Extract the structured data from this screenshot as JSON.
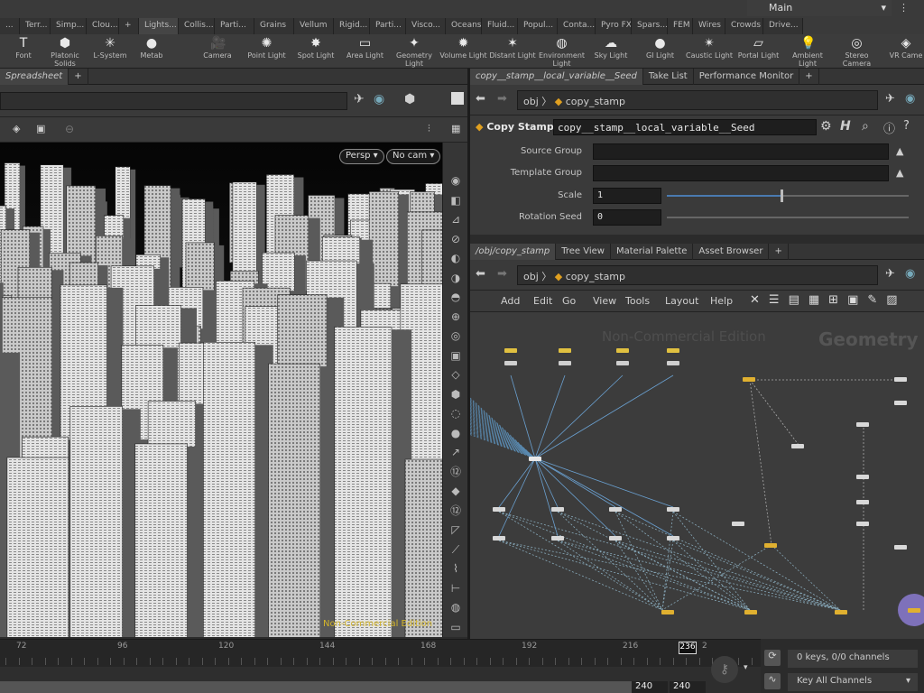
{
  "shelf_tabs": [
    "...",
    "Terr...",
    "Simp...",
    "Clou...",
    "+",
    "Lights...",
    "Collis...",
    "Parti...",
    "Grains",
    "Vellum",
    "Rigid...",
    "Parti...",
    "Visco...",
    "Oceans",
    "Fluid...",
    "Popul...",
    "Conta...",
    "Pyro FX",
    "Spars...",
    "FEM",
    "Wires",
    "Crowds",
    "Drive..."
  ],
  "desktop": "Main",
  "tools_left": [
    {
      "label": "Font",
      "icon": "T"
    },
    {
      "label": "Platonic Solids",
      "icon": "⬢"
    },
    {
      "label": "L-System",
      "icon": "✳"
    },
    {
      "label": "Metab",
      "icon": "●"
    }
  ],
  "tools_right": [
    {
      "label": "Camera",
      "icon": "🎥"
    },
    {
      "label": "Point Light",
      "icon": "✺"
    },
    {
      "label": "Spot Light",
      "icon": "✸"
    },
    {
      "label": "Area Light",
      "icon": "▭"
    },
    {
      "label": "Geometry Light",
      "icon": "✦"
    },
    {
      "label": "Volume Light",
      "icon": "✹"
    },
    {
      "label": "Distant Light",
      "icon": "✶"
    },
    {
      "label": "Environment Light",
      "icon": "◍"
    },
    {
      "label": "Sky Light",
      "icon": "☁"
    },
    {
      "label": "GI Light",
      "icon": "●"
    },
    {
      "label": "Caustic Light",
      "icon": "✴"
    },
    {
      "label": "Portal Light",
      "icon": "▱"
    },
    {
      "label": "Ambient Light",
      "icon": "💡"
    },
    {
      "label": "Stereo Camera",
      "icon": "◎"
    },
    {
      "label": "VR Came",
      "icon": "◈"
    }
  ],
  "left_pane": {
    "tab": "Spreadsheet",
    "persp": "Persp",
    "cam": "No cam",
    "watermark": "Non-Commercial Edition"
  },
  "right_top": {
    "tabs": [
      "copy__stamp__local_variable__Seed",
      "Take List",
      "Performance Monitor"
    ],
    "path_root": "obj",
    "path_node": "copy_stamp",
    "node_type": "Copy Stamp",
    "node_name": "copy__stamp__local_variable__Seed",
    "params": [
      {
        "label": "Source Group",
        "value": ""
      },
      {
        "label": "Template Group",
        "value": ""
      },
      {
        "label": "Scale",
        "value": "1"
      },
      {
        "label": "Rotation Seed",
        "value": "0"
      }
    ]
  },
  "right_bottom": {
    "tabs": [
      "/obj/copy_stamp",
      "Tree View",
      "Material Palette",
      "Asset Browser"
    ],
    "path_root": "obj",
    "path_node": "copy_stamp",
    "menu": [
      "Add",
      "Edit",
      "Go",
      "View",
      "Tools",
      "Layout",
      "Help"
    ],
    "watermark": "Non-Commercial Edition",
    "context": "Geometry"
  },
  "timeline": {
    "ticks": [
      "72",
      "96",
      "120",
      "144",
      "168",
      "192",
      "216"
    ],
    "current": "236",
    "end_a": "240",
    "end_b": "240",
    "keys": "0 keys, 0/0 channels",
    "key_all": "Key All Channels",
    "side": "2"
  }
}
